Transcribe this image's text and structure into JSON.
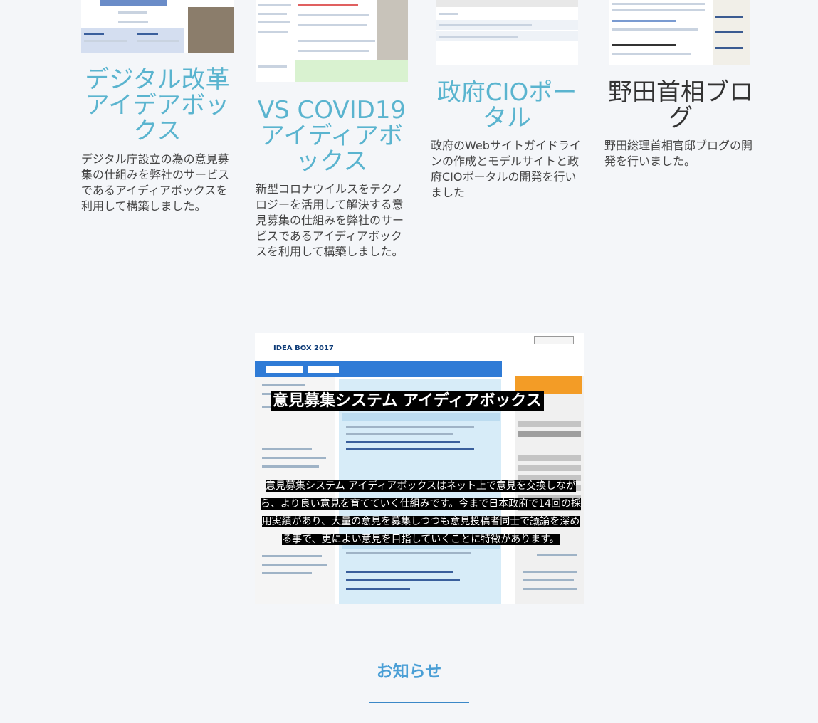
{
  "projects": [
    {
      "title": "デジタル改革アイデアボックス",
      "description": "デジタル庁設立の為の意見募集の仕組みを弊社のサービスであるアイディアボックスを利用して構築しました。"
    },
    {
      "title": "VS COVID19アイディアボックス",
      "description": "新型コロナウイルスをテクノロジーを活用して解決する意見募集の仕組みを弊社のサービスであるアイディアボックスを利用して構築しました。"
    },
    {
      "title": "政府CIOポータル",
      "description": "政府のWebサイトガイドラインの作成とモデルサイトと政府CIOポータルの開発を行いました"
    },
    {
      "title": "野田首相ブログ",
      "description": "野田総理首相官邸ブログの開発を行いました。"
    }
  ],
  "feature": {
    "title": "意見募集システム アイディアボックス",
    "lines": [
      "意見募集システム アイディアボックスはネット上で意見を交換しなが",
      "ら、より良い意見を育てていく仕組みです。今まで日本政府で14回の採",
      "用実績があり、大量の意見を募集しつつも意見投稿者同士で議論を深め",
      "る事で、更によい意見を目指していくことに特徴があります。"
    ],
    "screenshot_logo": "IDEA BOX 2017"
  },
  "news": {
    "heading": "お知らせ"
  },
  "colors": {
    "title_accent": "#5ab4cf",
    "news_accent": "#4a9fd6",
    "underline": "#3b88c8"
  }
}
